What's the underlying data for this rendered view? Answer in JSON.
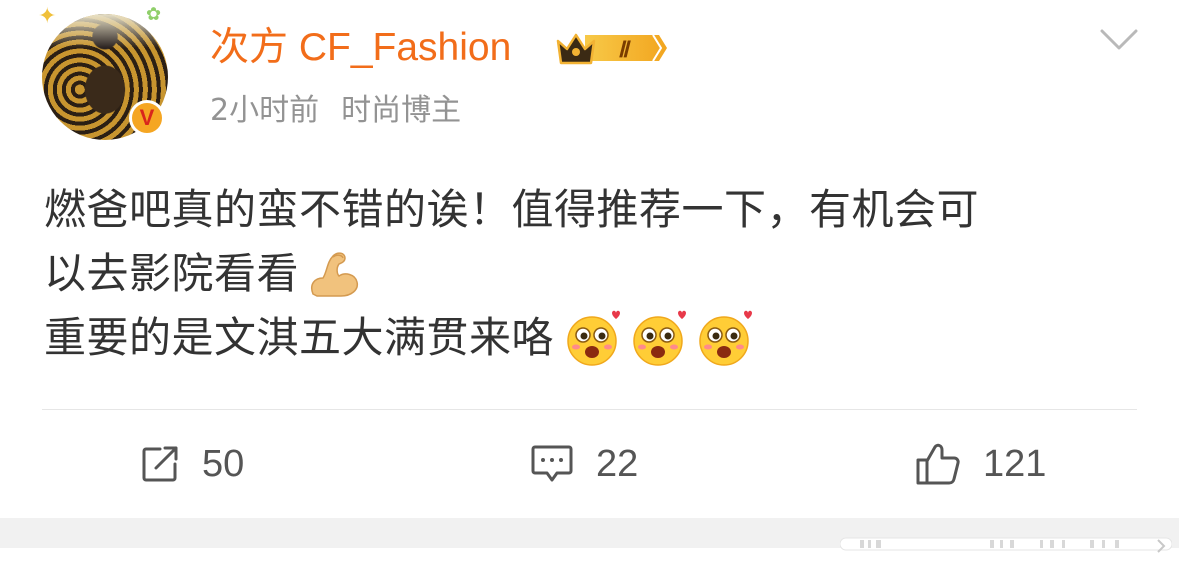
{
  "post": {
    "username": "次方 CF_Fashion",
    "vip_level": "Ⅱ",
    "time": "2小时前",
    "user_type": "时尚博主",
    "content_lines": [
      "燃爸吧真的蛮不错的诶！值得推荐一下，有机会可",
      "以去影院看看",
      "重要的是文淇五大满贯来咯"
    ],
    "line2_emoji": "flexed-biceps-emoji",
    "line3_emojis": [
      "heart-eyes-emoji",
      "heart-eyes-emoji",
      "heart-eyes-emoji"
    ]
  },
  "actions": {
    "repost_count": "50",
    "comment_count": "22",
    "like_count": "121"
  },
  "colors": {
    "username": "#f26d1a",
    "meta": "#939393",
    "text": "#333333",
    "icon": "#555555"
  }
}
